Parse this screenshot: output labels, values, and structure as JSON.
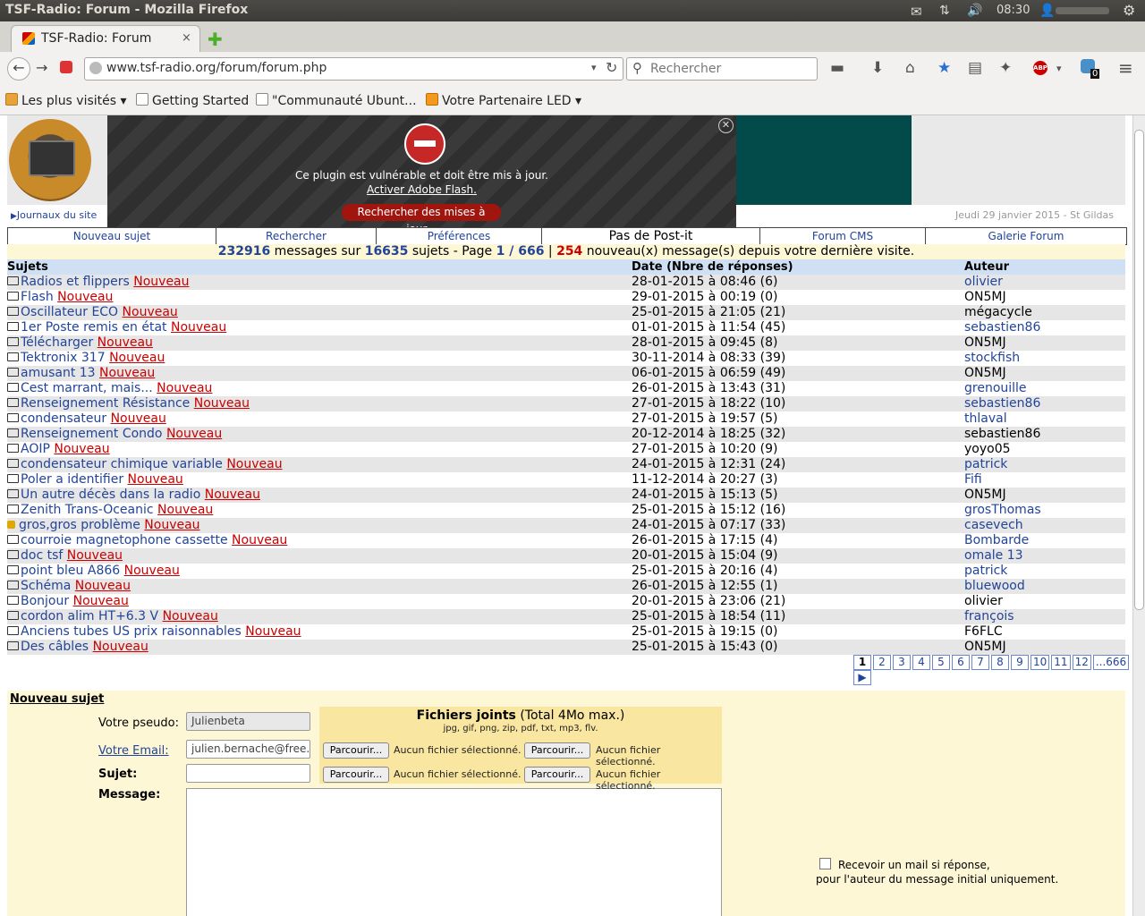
{
  "os": {
    "window_title": "TSF-Radio: Forum - Mozilla Firefox",
    "time": "08:30"
  },
  "tab": {
    "title": "TSF-Radio: Forum",
    "close": "×",
    "new": "✚"
  },
  "nav": {
    "url": "www.tsf-radio.org/forum/forum.php",
    "search_placeholder": "Rechercher",
    "badge": "0"
  },
  "bookmarks": [
    {
      "label": "Les plus visités ▾"
    },
    {
      "label": "Getting Started"
    },
    {
      "label": "\"Communauté Ubunt..."
    },
    {
      "label": "Votre Partenaire LED ▾"
    }
  ],
  "site": {
    "sidebar_link": "Journaux du site",
    "date": "Jeudi 29 janvier 2015 - St Gildas"
  },
  "flash": {
    "message": "Ce plugin est vulnérable et doit être mis à jour.",
    "link": "Activer Adobe Flash.",
    "button": "Rechercher des mises à jour..."
  },
  "menu": [
    "Nouveau sujet",
    "Rechercher",
    "Préférences",
    "Pas de Post-it",
    "Forum CMS",
    "Galerie Forum"
  ],
  "stats": {
    "messages": "232916",
    "t1": " messages sur ",
    "sujets": "16635",
    "t2": " sujets - Page ",
    "page": "1 / 666",
    "t3": " | ",
    "new": "254",
    "t4": " nouveau(x) message(s) depuis votre dernière visite."
  },
  "table": {
    "headers": [
      "Sujets",
      "Date (Nbre de réponses)",
      "Auteur"
    ],
    "new_label": "Nouveau",
    "rows": [
      {
        "subject": "Radios et flippers",
        "date": "28-01-2015 à 08:46 (6)",
        "author": "olivier",
        "link": true
      },
      {
        "subject": "Flash",
        "date": "29-01-2015 à 00:19 (0)",
        "author": "ON5MJ",
        "link": false
      },
      {
        "subject": "Oscillateur ECO",
        "date": "25-01-2015 à 21:05 (21)",
        "author": "mégacycle",
        "link": false
      },
      {
        "subject": "1er Poste remis en état",
        "date": "01-01-2015 à 11:54 (45)",
        "author": "sebastien86",
        "link": true
      },
      {
        "subject": "Télécharger",
        "date": "28-01-2015 à 09:45 (8)",
        "author": "ON5MJ",
        "link": false
      },
      {
        "subject": "Tektronix 317",
        "date": "30-11-2014 à 08:33 (39)",
        "author": "stockfish",
        "link": true
      },
      {
        "subject": "amusant 13",
        "date": "06-01-2015 à 06:59 (49)",
        "author": "ON5MJ",
        "link": false
      },
      {
        "subject": "Cest marrant, mais...",
        "date": "26-01-2015 à 13:43 (31)",
        "author": "grenouille",
        "link": true
      },
      {
        "subject": "Renseignement Résistance",
        "date": "27-01-2015 à 18:22 (10)",
        "author": "sebastien86",
        "link": true
      },
      {
        "subject": "condensateur",
        "date": "27-01-2015 à 19:57 (5)",
        "author": "thlaval",
        "link": true
      },
      {
        "subject": "Renseignement Condo",
        "date": "20-12-2014 à 18:25 (32)",
        "author": "sebastien86",
        "link": false
      },
      {
        "subject": "AOIP",
        "date": "27-01-2015 à 10:20 (9)",
        "author": "yoyo05",
        "link": false
      },
      {
        "subject": "condensateur chimique variable",
        "date": "24-01-2015 à 12:31 (24)",
        "author": "patrick",
        "link": true
      },
      {
        "subject": "Poler a identifier",
        "date": "11-12-2014 à 20:27 (3)",
        "author": "Fifi",
        "link": true
      },
      {
        "subject": "Un autre décès dans la radio",
        "date": "24-01-2015 à 15:13 (5)",
        "author": "ON5MJ",
        "link": false
      },
      {
        "subject": "Zenith Trans-Oceanic",
        "date": "25-01-2015 à 15:12 (16)",
        "author": "grosThomas",
        "link": true
      },
      {
        "subject": "gros,gros problème",
        "date": "24-01-2015 à 07:17 (33)",
        "author": "casevech",
        "link": true,
        "locked": true
      },
      {
        "subject": "courroie magnetophone cassette",
        "date": "26-01-2015 à 17:15 (4)",
        "author": "Bombarde",
        "link": true
      },
      {
        "subject": "doc tsf",
        "date": "20-01-2015 à 15:04 (9)",
        "author": "omale 13",
        "link": true
      },
      {
        "subject": "point bleu A866",
        "date": "25-01-2015 à 20:16 (4)",
        "author": "patrick",
        "link": true
      },
      {
        "subject": "Schéma",
        "date": "26-01-2015 à 12:55 (1)",
        "author": "bluewood",
        "link": true
      },
      {
        "subject": "Bonjour",
        "date": "20-01-2015 à 23:06 (21)",
        "author": "olivier",
        "link": false
      },
      {
        "subject": "cordon alim HT+6.3 V",
        "date": "25-01-2015 à 18:54 (11)",
        "author": "françois",
        "link": true
      },
      {
        "subject": "Anciens tubes US prix raisonnables",
        "date": "25-01-2015 à 19:15 (0)",
        "author": "F6FLC",
        "link": false
      },
      {
        "subject": "Des câbles",
        "date": "25-01-2015 à 15:43 (0)",
        "author": "ON5MJ",
        "link": false
      }
    ]
  },
  "pager": [
    "1",
    "2",
    "3",
    "4",
    "5",
    "6",
    "7",
    "8",
    "9",
    "10",
    "11",
    "12",
    "...666",
    "▶"
  ],
  "form": {
    "title": "Nouveau sujet",
    "pseudo_label": "Votre pseudo:",
    "pseudo_value": "Julienbeta",
    "email_label": "Votre Email:",
    "email_value": "julien.bernache@free.fr",
    "subject_label": "Sujet:",
    "message_label": "Message:",
    "att_title_bold": "Fichiers joints",
    "att_title_rest": " (Total 4Mo max.)",
    "att_types": "jpg, gif, png, zip, pdf, txt, mp3, flv.",
    "browse": "Parcourir...",
    "no_file": "Aucun fichier sélectionné.",
    "notify_line1": "Recevoir un mail si réponse,",
    "notify_line2": "pour l'auteur du message initial uniquement."
  }
}
